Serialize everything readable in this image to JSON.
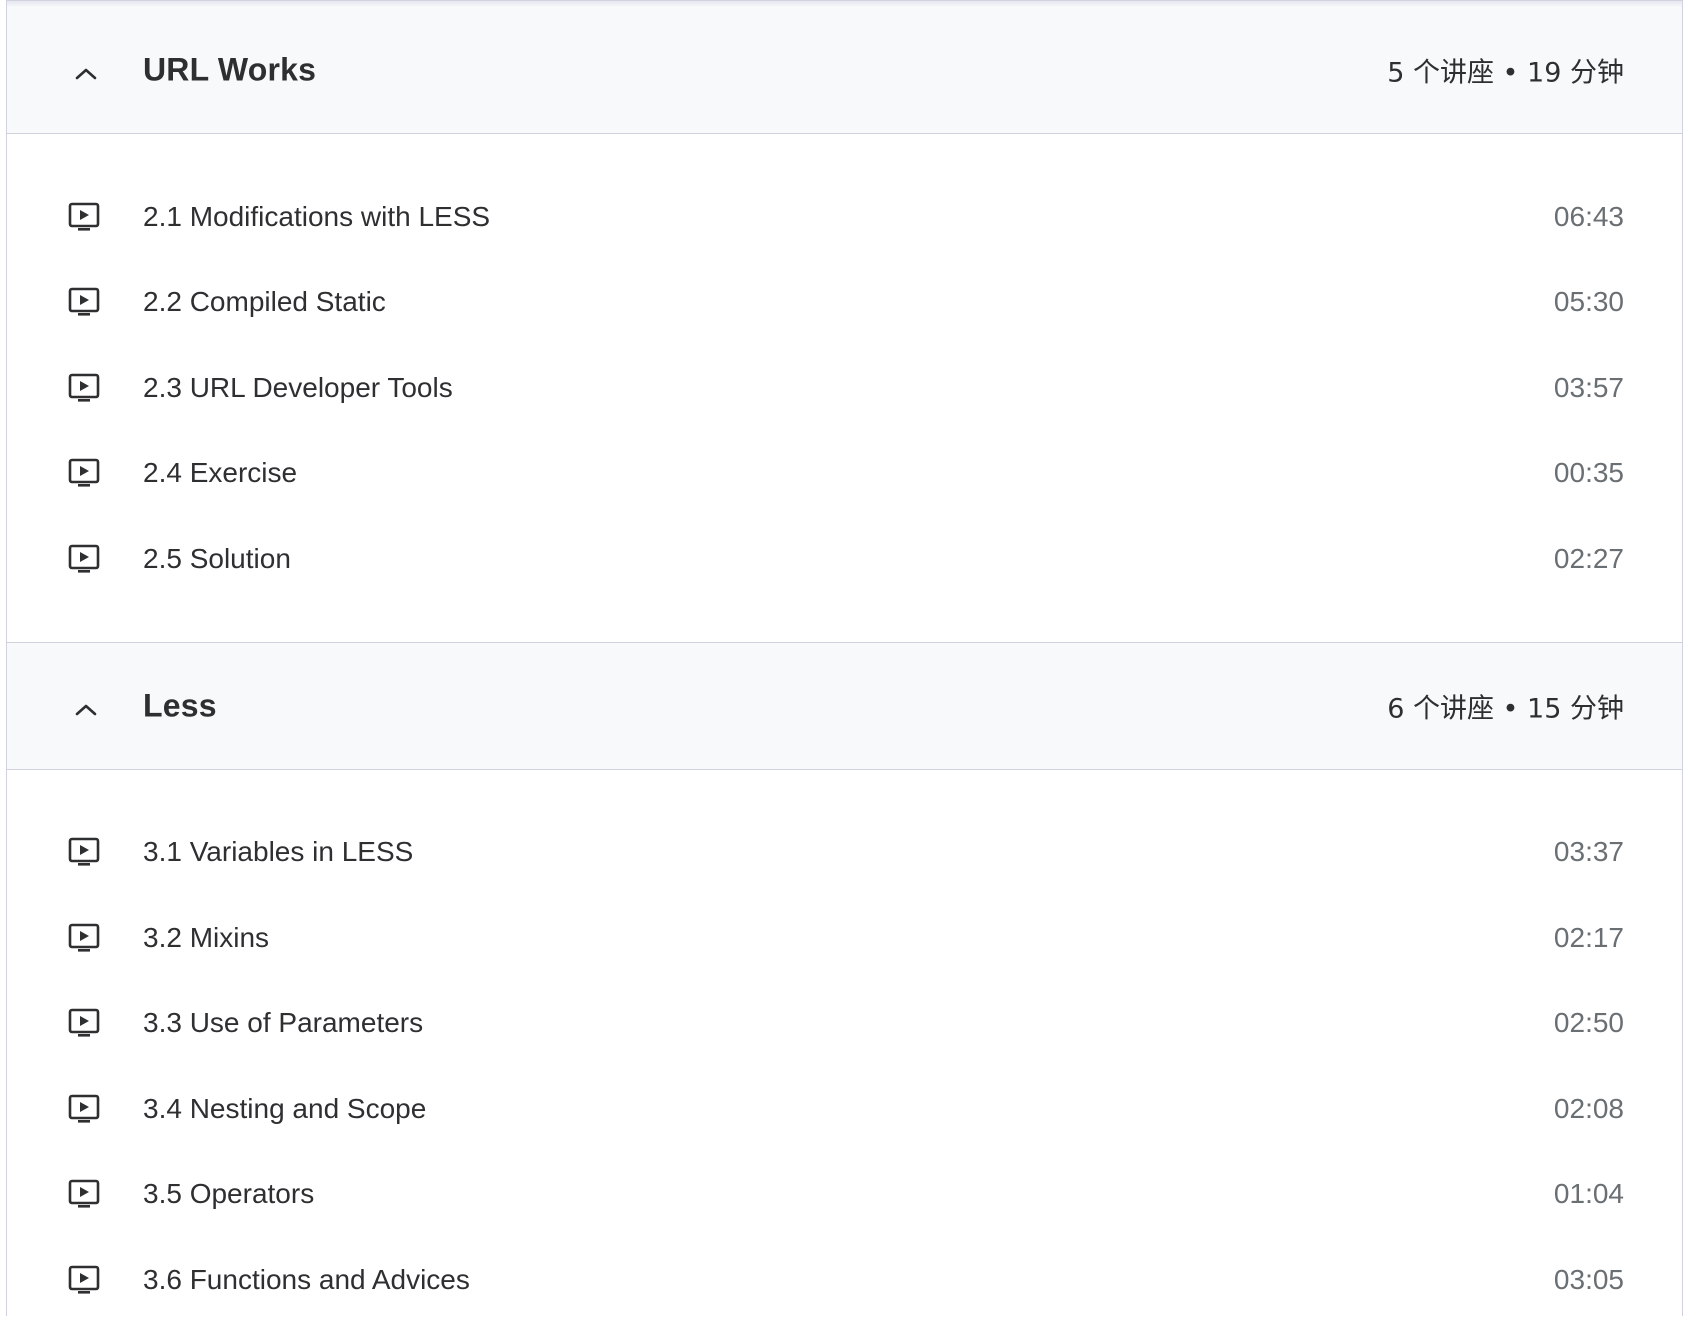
{
  "sections": [
    {
      "title": "URL Works",
      "meta": "5 个讲座 • 19 分钟",
      "expanded_icon": "chevron-up-icon",
      "lectures": [
        {
          "title": "2.1 Modifications with LESS",
          "duration": "06:43",
          "icon": "video-play-icon"
        },
        {
          "title": "2.2 Compiled Static",
          "duration": "05:30",
          "icon": "video-play-icon"
        },
        {
          "title": "2.3 URL Developer Tools",
          "duration": "03:57",
          "icon": "video-play-icon"
        },
        {
          "title": "2.4 Exercise",
          "duration": "00:35",
          "icon": "video-play-icon"
        },
        {
          "title": "2.5 Solution",
          "duration": "02:27",
          "icon": "video-play-icon"
        }
      ]
    },
    {
      "title": "Less",
      "meta": "6 个讲座 • 15 分钟",
      "expanded_icon": "chevron-up-icon",
      "lectures": [
        {
          "title": "3.1 Variables in LESS",
          "duration": "03:37",
          "icon": "video-play-icon"
        },
        {
          "title": "3.2 Mixins",
          "duration": "02:17",
          "icon": "video-play-icon"
        },
        {
          "title": "3.3 Use of Parameters",
          "duration": "02:50",
          "icon": "video-play-icon"
        },
        {
          "title": "3.4 Nesting and Scope",
          "duration": "02:08",
          "icon": "video-play-icon"
        },
        {
          "title": "3.5 Operators",
          "duration": "01:04",
          "icon": "video-play-icon"
        },
        {
          "title": "3.6 Functions and Advices",
          "duration": "03:05",
          "icon": "video-play-icon"
        }
      ]
    }
  ],
  "colors": {
    "header_bg": "#f7f9fa",
    "border": "#d1d2e0",
    "text": "#2d2f31",
    "muted": "#6a6f73"
  }
}
